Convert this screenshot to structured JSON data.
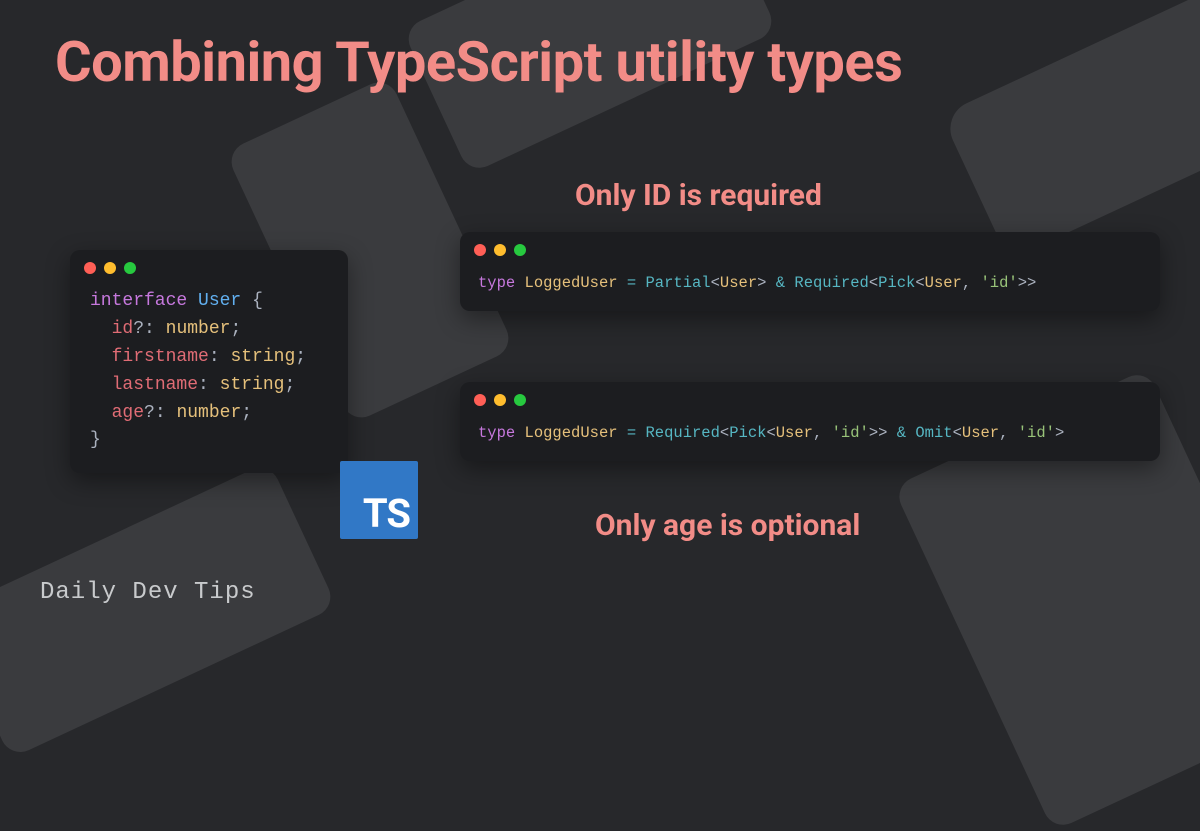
{
  "title": "Combining TypeScript utility types",
  "annotations": {
    "only_id_required": "Only ID is required",
    "only_age_optional": "Only age is optional"
  },
  "code": {
    "interface": {
      "keyword": "interface",
      "name": "User",
      "open": "{",
      "close": "}",
      "fields": [
        {
          "name": "id",
          "optional": true,
          "type": "number"
        },
        {
          "name": "firstname",
          "optional": false,
          "type": "string"
        },
        {
          "name": "lastname",
          "optional": false,
          "type": "string"
        },
        {
          "name": "age",
          "optional": true,
          "type": "number"
        }
      ]
    },
    "type1": {
      "keyword": "type",
      "name": "LoggedUser",
      "eq": "=",
      "partial": "Partial",
      "user": "User",
      "amp": "&",
      "required": "Required",
      "pick": "Pick",
      "id_literal": "'id'"
    },
    "type2": {
      "keyword": "type",
      "name": "LoggedUser",
      "eq": "=",
      "required": "Required",
      "pick": "Pick",
      "user": "User",
      "id_literal": "'id'",
      "amp": "&",
      "omit": "Omit"
    }
  },
  "logo": {
    "text": "TS"
  },
  "brand": "Daily Dev Tips"
}
